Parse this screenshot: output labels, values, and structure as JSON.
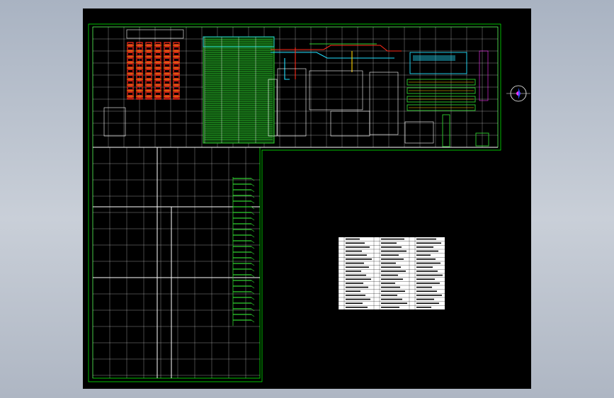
{
  "viewport": {
    "background": "#000000",
    "app_background": "#b8c0cc"
  },
  "colors": {
    "grid": "#ffffff",
    "border": "#00ff00",
    "accent_green": "#2fd12f",
    "red_equipment": "#ff2a1a",
    "yellow": "#ffd400",
    "cyan": "#22e0ff",
    "blue": "#3050ff",
    "magenta": "#ff33ff",
    "legend_bg": "#ffffff"
  },
  "north_arrow": {
    "icon": "north-arrow-icon"
  },
  "legend_table": {
    "rows": 18,
    "columns": 6
  }
}
